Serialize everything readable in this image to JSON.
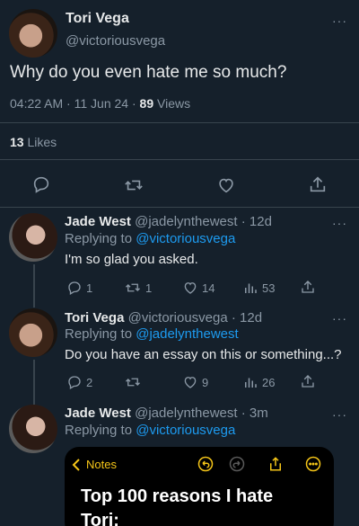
{
  "main_tweet": {
    "name": "Tori Vega",
    "handle": "@victoriousvega",
    "text": "Why do you even hate me so much?",
    "time": "04:22 AM",
    "date": "11 Jun 24",
    "views_count": "89",
    "views_label": "Views",
    "likes_count": "13",
    "likes_label": "Likes",
    "more": "···"
  },
  "replies": [
    {
      "name": "Jade West",
      "handle": "@jadelynthewest",
      "age": "· 12d",
      "replying_label": "Replying to",
      "replying_to": "@victoriousvega",
      "text": "I'm so glad you asked.",
      "replies": "1",
      "retweets": "1",
      "likes": "14",
      "views": "53",
      "more": "···"
    },
    {
      "name": "Tori Vega",
      "handle": "@victoriousvega",
      "age": "· 12d",
      "replying_label": "Replying to",
      "replying_to": "@jadelynthewest",
      "text": "Do you have an essay on this or something...?",
      "replies": "2",
      "retweets": "",
      "likes": "9",
      "views": "26",
      "more": "···"
    },
    {
      "name": "Jade West",
      "handle": "@jadelynthewest",
      "age": "· 3m",
      "replying_label": "Replying to",
      "replying_to": "@victoriousvega",
      "more": "···"
    }
  ],
  "notes_image": {
    "back_label": "Notes",
    "title": "Top 100 reasons I hate Tori:"
  },
  "colors": {
    "background": "#15202b",
    "accent": "#1d9bf0",
    "notes_accent": "#f5c518"
  }
}
